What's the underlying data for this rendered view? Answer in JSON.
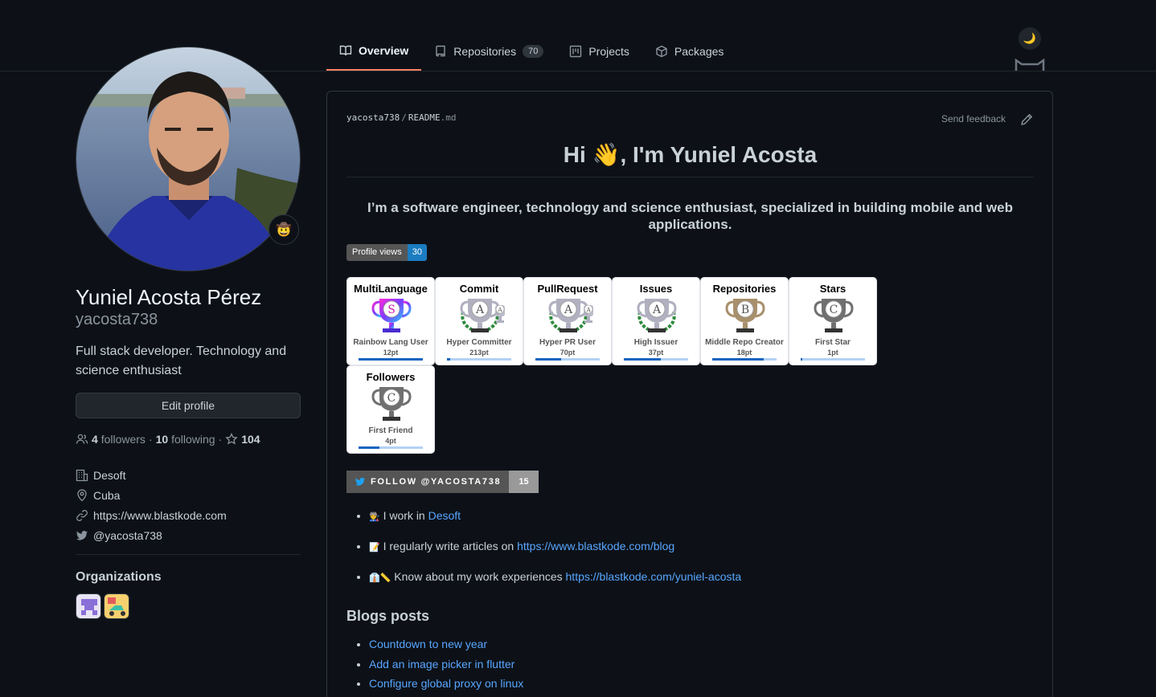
{
  "tabs": [
    {
      "label": "Overview",
      "icon": "book-icon",
      "active": true
    },
    {
      "label": "Repositories",
      "icon": "repo-icon",
      "count": "70"
    },
    {
      "label": "Projects",
      "icon": "project-icon"
    },
    {
      "label": "Packages",
      "icon": "package-icon"
    }
  ],
  "theme_toggle": "🌙",
  "profile": {
    "status_emoji": "🤠",
    "full_name": "Yuniel Acosta Pérez",
    "username": "yacosta738",
    "bio": "Full stack developer. Technology and science enthusiast",
    "edit_label": "Edit profile",
    "followers_count": "4",
    "followers_label": "followers",
    "following_count": "10",
    "following_label": "following",
    "stars_count": "104",
    "company": "Desoft",
    "location": "Cuba",
    "website": "https://www.blastkode.com",
    "twitter": "@yacosta738",
    "orgs_title": "Organizations"
  },
  "readme": {
    "crumb_user": "yacosta738",
    "crumb_file": "README",
    "crumb_ext": ".md",
    "feedback": "Send feedback",
    "heading": "Hi 👋, I'm Yuniel Acosta",
    "tagline": "I’m a software engineer, technology and science enthusiast, specialized in building mobile and web applications.",
    "views_label": "Profile views",
    "views_count": "30",
    "twitter_label": "FOLLOW @YACOSTA738",
    "twitter_count": "15",
    "bullets": [
      {
        "emoji": "👨‍🏭",
        "text": "I work in ",
        "link": "Desoft"
      },
      {
        "emoji": "📝",
        "text": "I regularly write articles on ",
        "link": "https://www.blastkode.com/blog"
      },
      {
        "emoji": "👔📏",
        "text": "Know about my work experiences ",
        "link": "https://blastkode.com/yuniel-acosta"
      }
    ],
    "blogs_title": "Blogs posts",
    "blogs": [
      "Countdown to new year",
      "Add an image picker in flutter",
      "Configure global proxy on linux"
    ]
  },
  "trophies": [
    {
      "title": "MultiLanguage",
      "rank": "S",
      "name": "Rainbow Lang User",
      "pt": "12pt",
      "progress": 1.0,
      "color": "rainbow",
      "laurel": false
    },
    {
      "title": "Commit",
      "rank": "A",
      "name": "Hyper Committer",
      "pt": "213pt",
      "progress": 0.05,
      "color": "#b0b0c0",
      "laurel": true,
      "mini": "A"
    },
    {
      "title": "PullRequest",
      "rank": "A",
      "name": "Hyper PR User",
      "pt": "70pt",
      "progress": 0.4,
      "color": "#b0b0c0",
      "laurel": true,
      "mini": "A"
    },
    {
      "title": "Issues",
      "rank": "A",
      "name": "High Issuer",
      "pt": "37pt",
      "progress": 0.57,
      "color": "#b0b0c0",
      "laurel": true
    },
    {
      "title": "Repositories",
      "rank": "B",
      "name": "Middle Repo Creator",
      "pt": "18pt",
      "progress": 0.8,
      "color": "#a8906c",
      "laurel": false
    },
    {
      "title": "Stars",
      "rank": "C",
      "name": "First Star",
      "pt": "1pt",
      "progress": 0.02,
      "color": "#707070",
      "laurel": false
    },
    {
      "title": "Followers",
      "rank": "C",
      "name": "First Friend",
      "pt": "4pt",
      "progress": 0.33,
      "color": "#707070",
      "laurel": false
    }
  ]
}
